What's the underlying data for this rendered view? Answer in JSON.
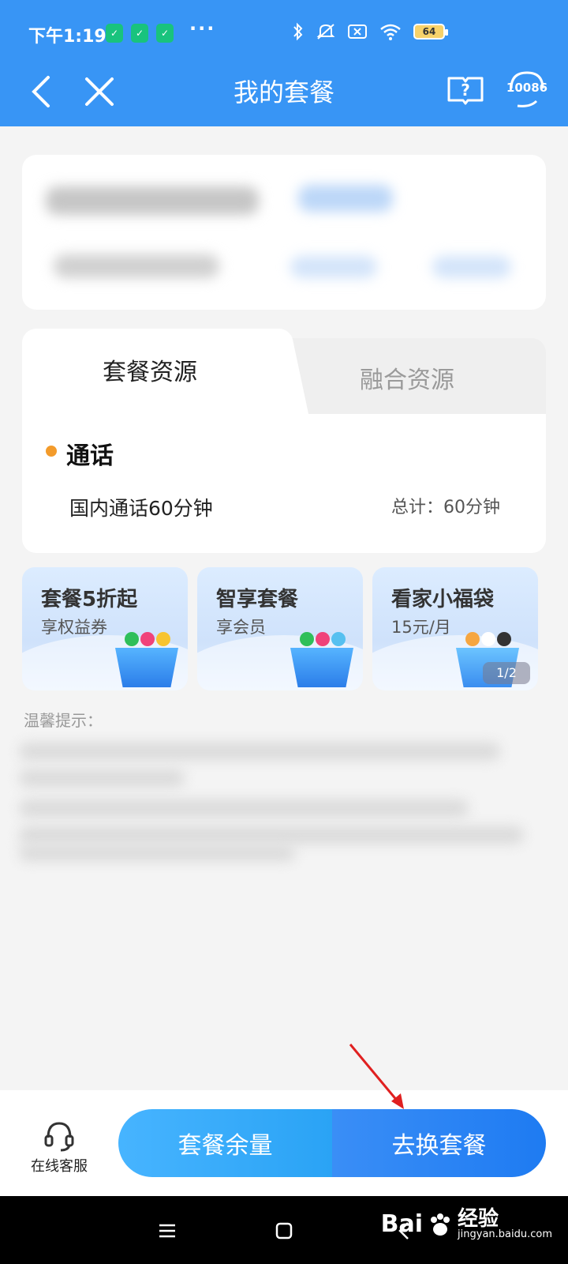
{
  "status_bar": {
    "time": "下午1:19",
    "battery": "64",
    "more": "···"
  },
  "header": {
    "title": "我的套餐",
    "service_number": "10086"
  },
  "tabs": [
    {
      "label": "套餐资源",
      "active": true
    },
    {
      "label": "融合资源",
      "active": false
    }
  ],
  "resource": {
    "category": "通话",
    "item": "国内通话60分钟",
    "total": "总计：60分钟"
  },
  "promos": [
    {
      "title": "套餐5折起",
      "subtitle": "享权益券"
    },
    {
      "title": "智享套餐",
      "subtitle": "享会员"
    },
    {
      "title": "看家小福袋",
      "subtitle": "15元/月"
    }
  ],
  "promo_page": "1/2",
  "tip_label": "温馨提示：",
  "bottom": {
    "service_label": "在线客服",
    "balance_button": "套餐余量",
    "change_button": "去换套餐"
  },
  "watermark": {
    "logo": "Bai",
    "cn": "经验",
    "url": "jingyan.baidu.com"
  },
  "colors": {
    "header_blue": "#3895f5",
    "accent_orange": "#f39b2b",
    "button_blue": "#1e7bf2"
  }
}
